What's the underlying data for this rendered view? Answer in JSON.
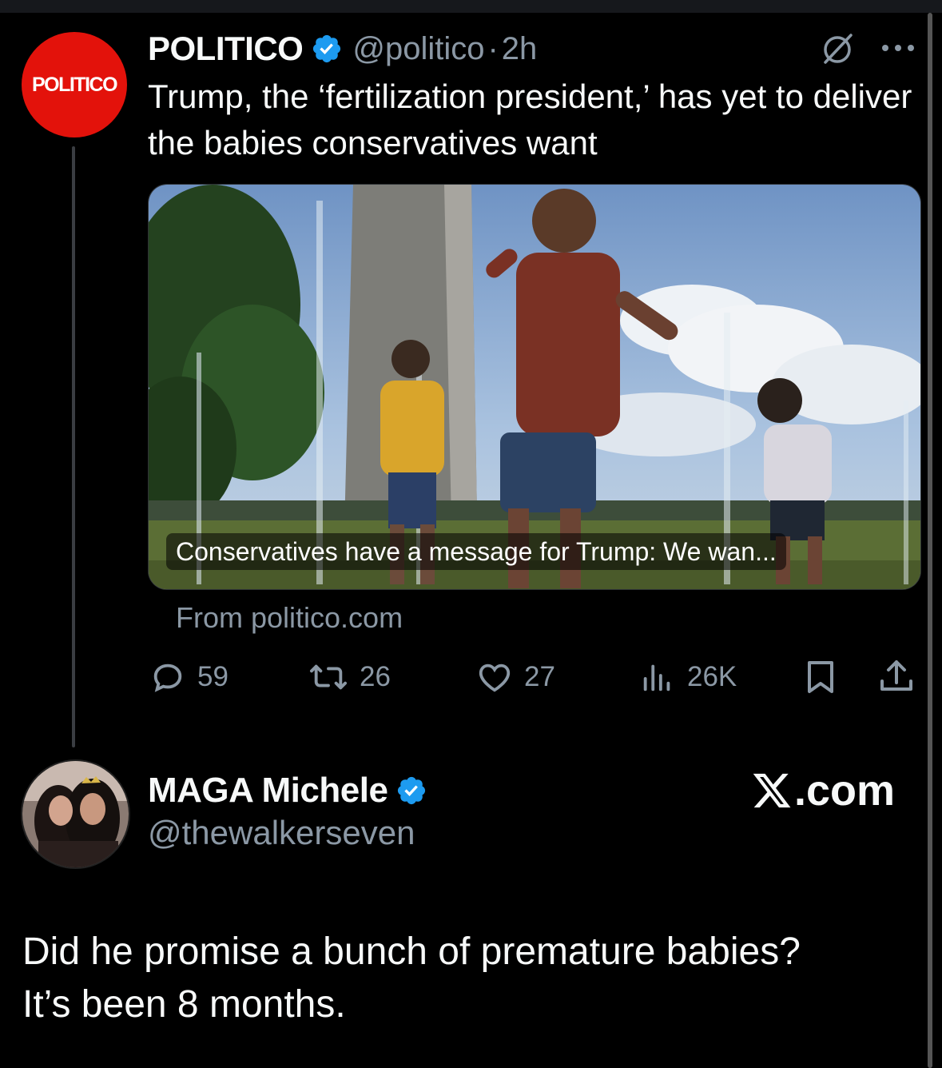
{
  "tweet": {
    "avatar_text": "POLITICO",
    "author": "POLITICO",
    "handle": "@politico",
    "separator": "·",
    "time": "2h",
    "text": "Trump, the ‘fertilization president,’ has yet to deliver the babies conservatives want",
    "card": {
      "caption": "Conservatives have a message for Trump: We wan...",
      "source": "From politico.com"
    },
    "actions": {
      "replies": "59",
      "reposts": "26",
      "likes": "27",
      "views": "26K"
    }
  },
  "reply": {
    "author": "MAGA Michele",
    "handle": "@thewalkerseven",
    "brand": ".com",
    "text_line1": "Did he promise a bunch of premature babies?",
    "text_line2": "It’s been 8 months."
  },
  "colors": {
    "background": "#000000",
    "politico_red": "#e3120b",
    "verified_blue": "#1d9bf0",
    "secondary_text": "#8b98a5"
  },
  "icons": [
    "verified-badge-icon",
    "grok-icon",
    "more-icon",
    "reply-icon",
    "repost-icon",
    "like-icon",
    "views-icon",
    "bookmark-icon",
    "share-icon",
    "x-logo-icon"
  ]
}
